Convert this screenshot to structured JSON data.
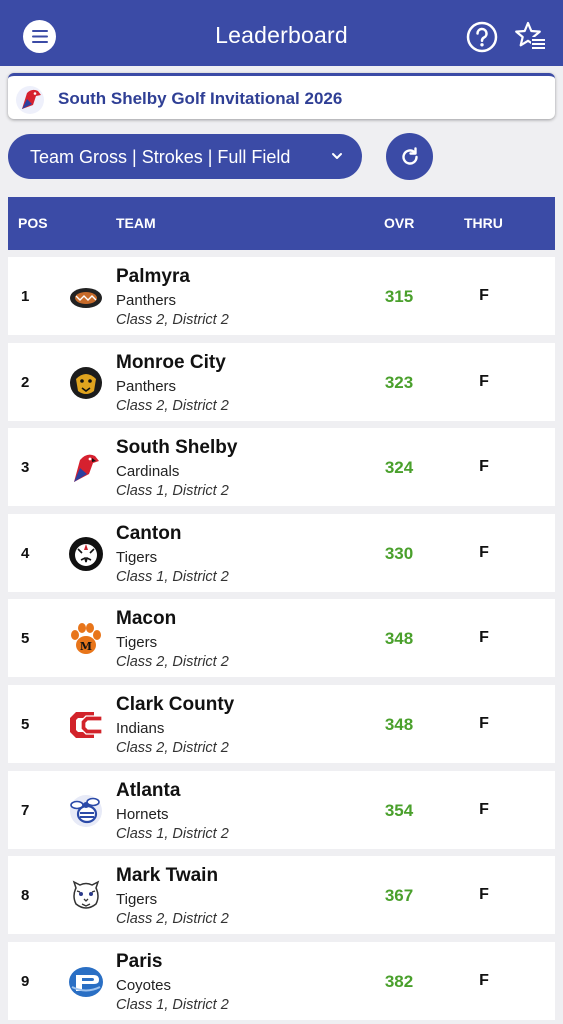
{
  "header": {
    "title": "Leaderboard"
  },
  "event": {
    "title": "South Shelby Golf Invitational 2026"
  },
  "filter": {
    "label": "Team Gross | Strokes | Full Field"
  },
  "colors": {
    "primary": "#3b4ba6",
    "score": "#4aa02c"
  },
  "table": {
    "columns": {
      "pos": "POS",
      "team": "TEAM",
      "ovr": "OVR",
      "thru": "THRU"
    },
    "rows": [
      {
        "pos": "1",
        "team": "Palmyra",
        "mascot": "Panthers",
        "division": "Class 2, District 2",
        "ovr": "315",
        "thru": "F",
        "logo": "panther-logo"
      },
      {
        "pos": "2",
        "team": "Monroe City",
        "mascot": "Panthers",
        "division": "Class 2, District 2",
        "ovr": "323",
        "thru": "F",
        "logo": "panther-logo"
      },
      {
        "pos": "3",
        "team": "South Shelby",
        "mascot": "Cardinals",
        "division": "Class 1, District 2",
        "ovr": "324",
        "thru": "F",
        "logo": "cardinal-logo"
      },
      {
        "pos": "4",
        "team": "Canton",
        "mascot": "Tigers",
        "division": "Class 1, District 2",
        "ovr": "330",
        "thru": "F",
        "logo": "tiger-logo"
      },
      {
        "pos": "5",
        "team": "Macon",
        "mascot": "Tigers",
        "division": "Class 2, District 2",
        "ovr": "348",
        "thru": "F",
        "logo": "paw-logo"
      },
      {
        "pos": "5",
        "team": "Clark County",
        "mascot": "Indians",
        "division": "Class 2, District 2",
        "ovr": "348",
        "thru": "F",
        "logo": "cc-logo"
      },
      {
        "pos": "7",
        "team": "Atlanta",
        "mascot": "Hornets",
        "division": "Class 1, District 2",
        "ovr": "354",
        "thru": "F",
        "logo": "hornet-logo"
      },
      {
        "pos": "8",
        "team": "Mark Twain",
        "mascot": "Tigers",
        "division": "Class 2, District 2",
        "ovr": "367",
        "thru": "F",
        "logo": "tiger-logo"
      },
      {
        "pos": "9",
        "team": "Paris",
        "mascot": "Coyotes",
        "division": "Class 1, District 2",
        "ovr": "382",
        "thru": "F",
        "logo": "coyote-logo"
      }
    ]
  }
}
